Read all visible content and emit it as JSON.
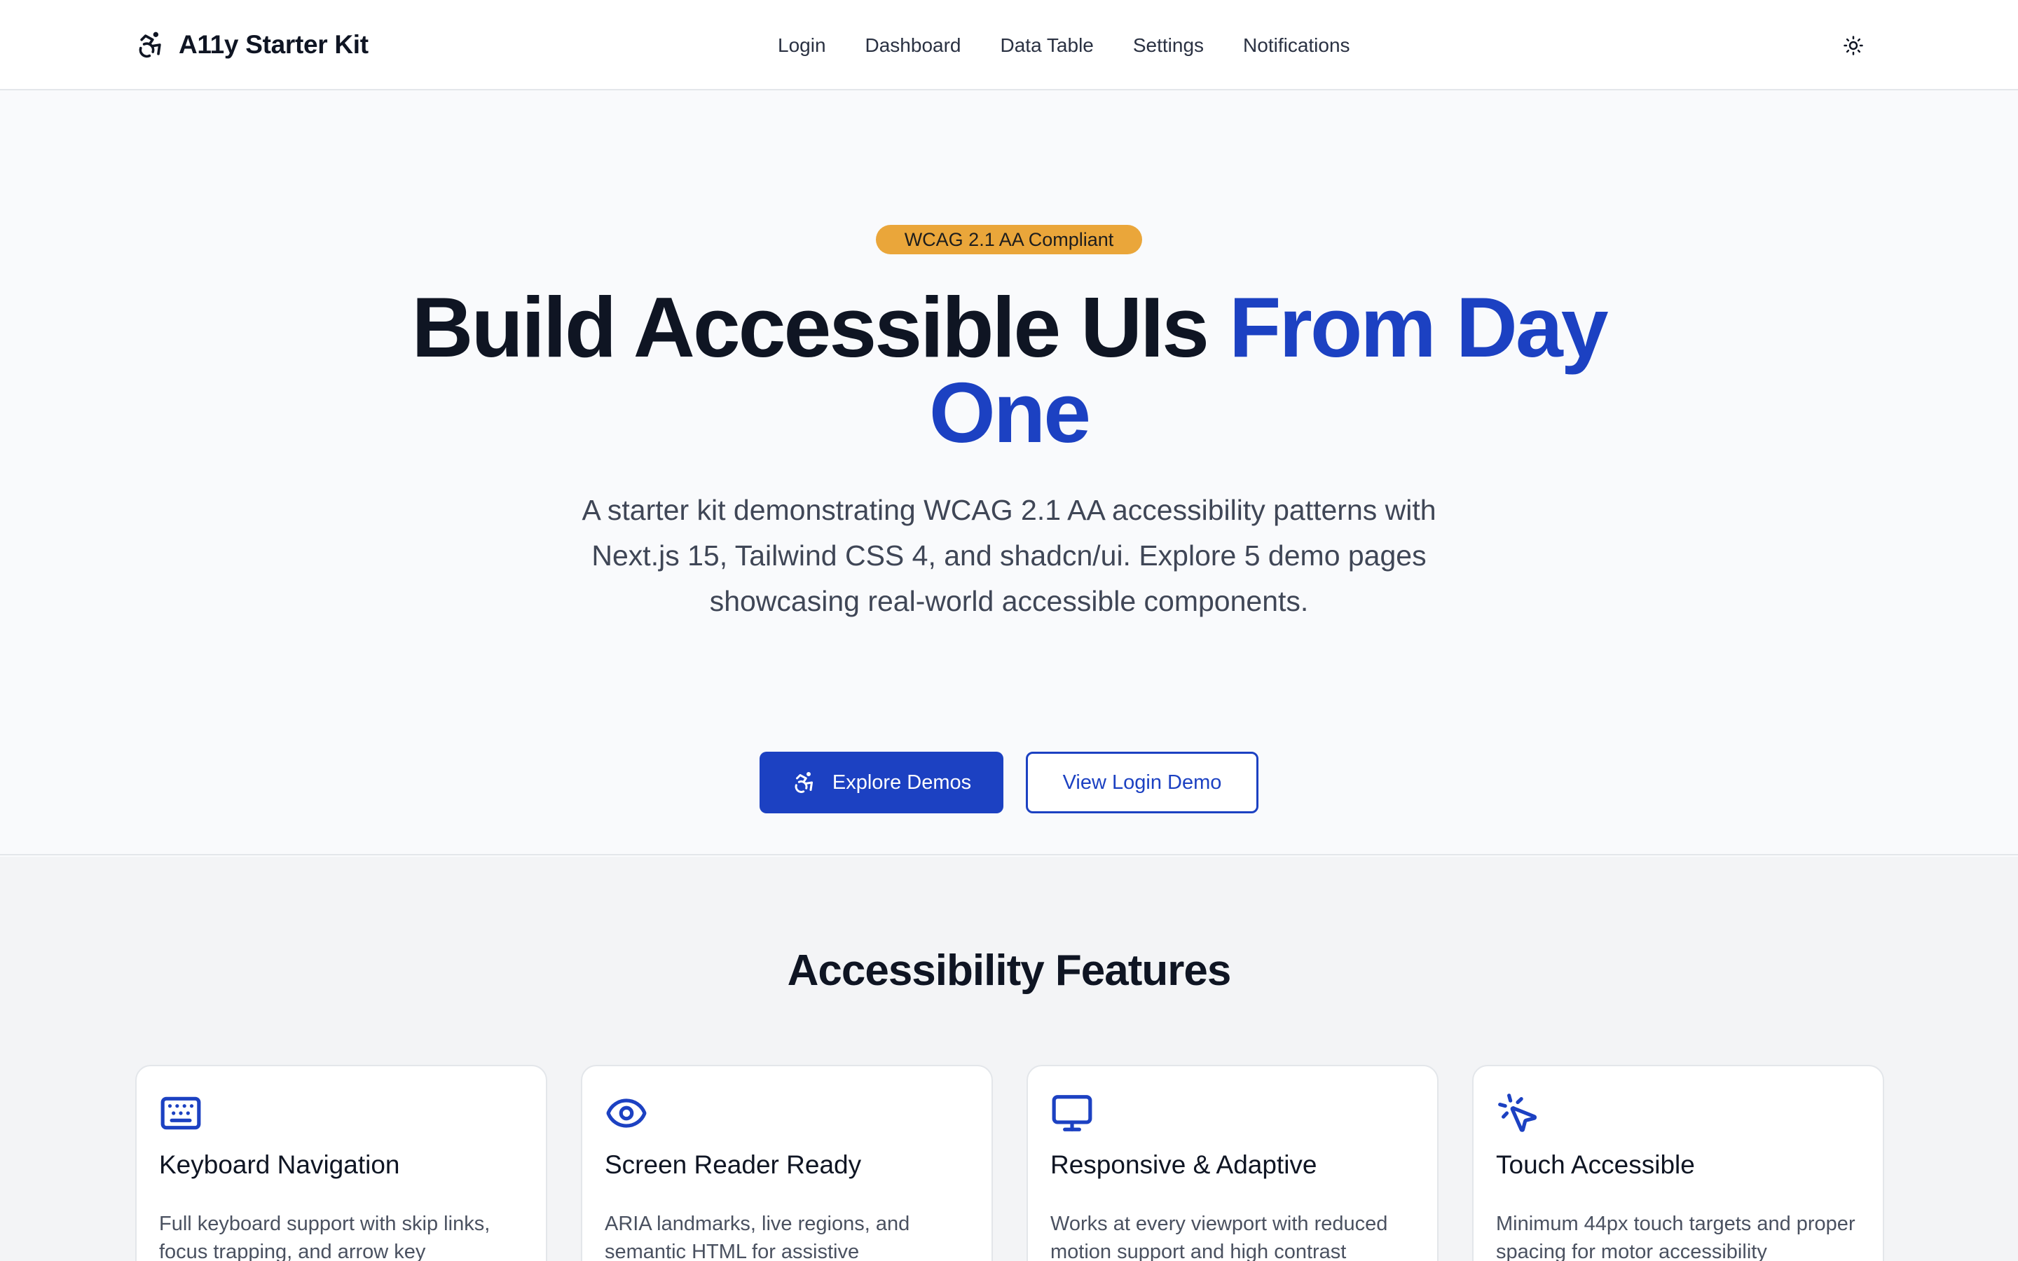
{
  "header": {
    "brand": "A11y Starter Kit",
    "nav": [
      "Login",
      "Dashboard",
      "Data Table",
      "Settings",
      "Notifications"
    ]
  },
  "hero": {
    "badge": "WCAG 2.1 AA Compliant",
    "title_part1": "Build Accessible UIs ",
    "title_accent": "From Day One",
    "subtitle": "A starter kit demonstrating WCAG 2.1 AA accessibility patterns with Next.js 15, Tailwind CSS 4, and shadcn/ui. Explore 5 demo pages showcasing real-world accessible components.",
    "primary_button": "Explore Demos",
    "secondary_button": "View Login Demo"
  },
  "features": {
    "title": "Accessibility Features",
    "cards": [
      {
        "icon": "keyboard-icon",
        "title": "Keyboard Navigation",
        "desc": "Full keyboard support with skip links, focus trapping, and arrow key"
      },
      {
        "icon": "eye-icon",
        "title": "Screen Reader Ready",
        "desc": "ARIA landmarks, live regions, and semantic HTML for assistive"
      },
      {
        "icon": "monitor-icon",
        "title": "Responsive & Adaptive",
        "desc": "Works at every viewport with reduced motion support and high contrast"
      },
      {
        "icon": "pointer-click-icon",
        "title": "Touch Accessible",
        "desc": "Minimum 44px touch targets and proper spacing for motor accessibility"
      }
    ]
  },
  "colors": {
    "accent": "#1c41c2",
    "badge": "#eaa63a",
    "background": "#f9fafc"
  }
}
